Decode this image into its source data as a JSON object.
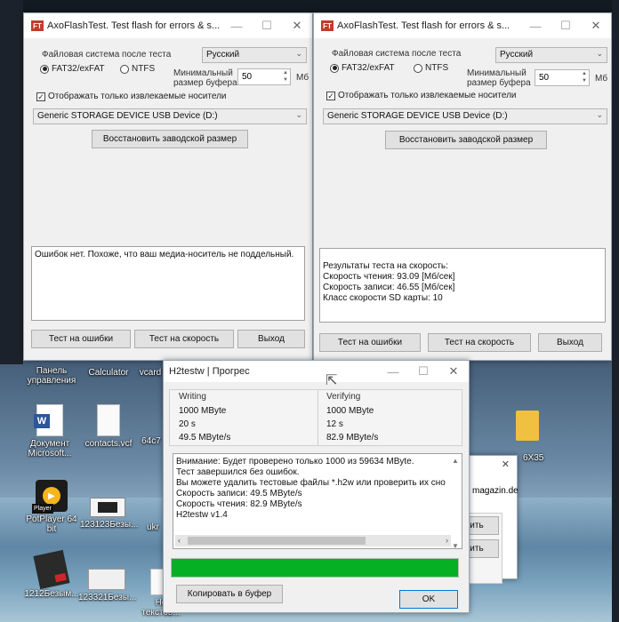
{
  "left_window": {
    "title": "AxoFlashTest. Test flash for errors & s...",
    "fs_label": "Файловая система после теста",
    "language": "Русский",
    "fs_option1": "FAT32/exFAT",
    "fs_option2": "NTFS",
    "buffer_label1": "Минимальный",
    "buffer_label2": "размер буфера",
    "buffer_value": "50",
    "buffer_unit": "Мб",
    "removable_label": "Отображать только извлекаемые носители",
    "device": "Generic STORAGE DEVICE USB Device (D:)",
    "restore_button": "Восстановить заводской размер",
    "log": [
      "Ошибок нет. Похоже, что ваш медиа-носитель не поддельный."
    ],
    "test_errors_button": "Тест на ошибки",
    "test_speed_button": "Тест на скорость",
    "exit_button": "Выход"
  },
  "right_window": {
    "title": "AxoFlashTest. Test flash for errors & s...",
    "fs_label": "Файловая система после теста",
    "language": "Русский",
    "fs_option1": "FAT32/exFAT",
    "fs_option2": "NTFS",
    "buffer_label1": "Минимальный",
    "buffer_label2": "размер буфера",
    "buffer_value": "50",
    "buffer_unit": "Мб",
    "removable_label": "Отображать только извлекаемые носители",
    "device": "Generic STORAGE DEVICE USB Device (D:)",
    "restore_button": "Восстановить заводской размер",
    "log": [
      "Результаты теста на скорость:",
      "Скорость чтения: 93.09 [Мб/сек]",
      "Скорость записи: 46.55 [Мб/сек]",
      "Класс скорости SD карты: 10"
    ],
    "test_errors_button": "Тест на ошибки",
    "test_speed_button": "Тест на скорость",
    "exit_button": "Выход"
  },
  "h2testw": {
    "title": "H2testw | Прогрес",
    "writing_head": "Writing",
    "writing_size": "1000 MByte",
    "writing_time": "20 s",
    "writing_speed": "49.5 MByte/s",
    "verifying_head": "Verifying",
    "verifying_size": "1000 MByte",
    "verifying_time": "12 s",
    "verifying_speed": "82.9 MByte/s",
    "log": [
      "Внимание: Будет проверено только 1000 из 59634 MByte.",
      "Тест завершился без ошибок.",
      "Вы можете удалить тестовые файлы *.h2w или проверить их сно",
      "Скорость записи: 49.5 MByte/s",
      "Скорость чтения: 82.9 MByte/s",
      "H2testw v1.4"
    ],
    "progress": 1.0,
    "copy_button": "Копировать в буфер",
    "ok_button": "OK"
  },
  "background_window": {
    "close": "✕",
    "text": "magazin.de",
    "btn1": "ить",
    "btn2": "ить"
  },
  "desktop": {
    "icons": [
      {
        "label": "Панель управления",
        "glyph": "panel-icon"
      },
      {
        "label": "Calculator",
        "glyph": "calculator-icon"
      },
      {
        "label": "vcard",
        "glyph": "file-icon"
      },
      {
        "label": "Документ Microsoft...",
        "glyph": "word-icon"
      },
      {
        "label": "contacts.vcf",
        "glyph": "file-icon"
      },
      {
        "label": "64c7",
        "glyph": "file-icon"
      },
      {
        "label": "PotPlayer 64 bit",
        "glyph": "potplayer-icon"
      },
      {
        "label": "123123Безы...",
        "glyph": "image-icon"
      },
      {
        "label": "ukr",
        "glyph": "file-icon"
      },
      {
        "label": "1212Безым...",
        "glyph": "image-icon"
      },
      {
        "label": "123321Безы...",
        "glyph": "image-icon"
      },
      {
        "label": "Но текстов...",
        "glyph": "file-icon"
      },
      {
        "label": "6X35",
        "glyph": "folder-icon"
      }
    ],
    "potplayer_badge": "Player"
  },
  "colors": {
    "progress": "#06b025",
    "accent": "#0078d7",
    "brand": "#c23b2c"
  }
}
